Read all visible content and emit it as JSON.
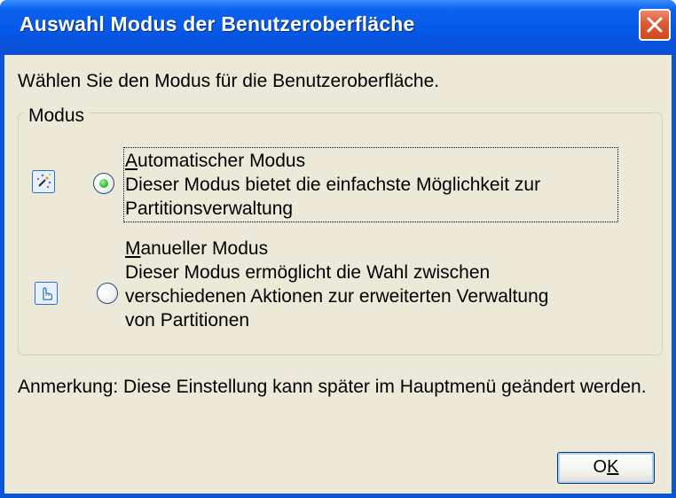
{
  "window": {
    "title": "Auswahl Modus der Benutzeroberfläche"
  },
  "intro_text": "Wählen Sie den Modus für die Benutzeroberfläche.",
  "group": {
    "legend": "Modus",
    "options": [
      {
        "title_accesskey": "A",
        "title_rest": "utomatischer Modus",
        "description_line1": "Dieser Modus bietet die einfachste Möglichkeit zur",
        "description_line2": "Partitionsverwaltung",
        "selected": true,
        "icon": "wand-sparkle-icon"
      },
      {
        "title_accesskey": "M",
        "title_rest": "anueller Modus",
        "description_line1": "Dieser Modus ermöglicht die Wahl zwischen",
        "description_line2": "verschiedenen Aktionen zur erweiterten Verwaltung",
        "description_line3": "von Partitionen",
        "selected": false,
        "icon": "hand-pointer-icon"
      }
    ]
  },
  "note_text": "Anmerkung: Diese Einstellung kann später im Hauptmenü geändert werden.",
  "ok_button": {
    "label_prefix": "O",
    "label_accesskey": "K"
  },
  "colors": {
    "title_bar": "#0a55d8",
    "client_bg": "#ece9d8",
    "close_button": "#d04a20",
    "radio_selected_dot": "#3cc43c"
  }
}
